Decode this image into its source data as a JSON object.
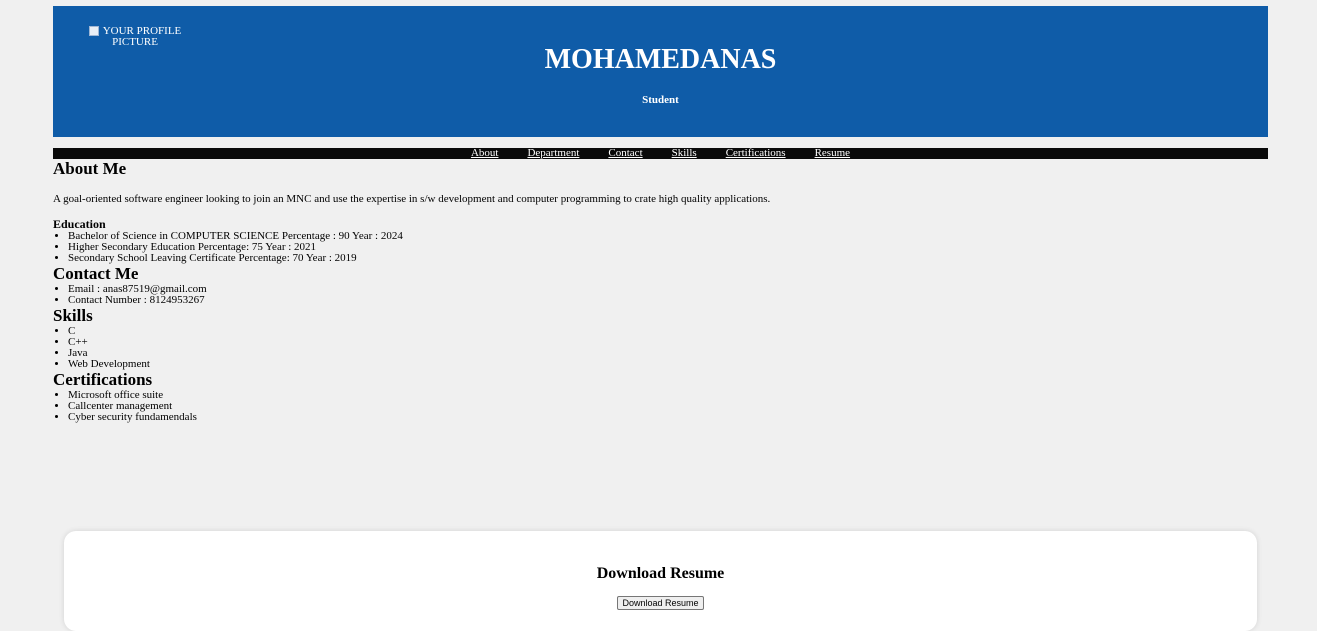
{
  "header": {
    "profile_alt": "YOUR PROFILE PICTURE",
    "name": "MOHAMEDANAS",
    "role": "Student",
    "background_color": "#0f5ca8"
  },
  "nav": {
    "items": [
      "About",
      "Department",
      "Contact",
      "Skills",
      "Certifications",
      "Resume"
    ]
  },
  "about": {
    "title": "About Me",
    "text": "A goal-oriented software engineer looking to join an MNC and use the expertise in s/w development and computer programming to crate high quality applications.",
    "education_title": "Education",
    "education": [
      "Bachelor of Science in COMPUTER SCIENCE Percentage : 90 Year : 2024",
      "Higher Secondary Education Percentage: 75 Year : 2021",
      "Secondary School Leaving Certificate Percentage: 70 Year : 2019"
    ]
  },
  "contact": {
    "title": "Contact Me",
    "items": [
      "Email : anas87519@gmail.com",
      "Contact Number : 8124953267"
    ]
  },
  "skills": {
    "title": "Skills",
    "items": [
      "C",
      "C++",
      "Java",
      "Web Development"
    ]
  },
  "certifications": {
    "title": "Certifications",
    "items": [
      "Microsoft office suite",
      "Callcenter management",
      "Cyber security fundamendals"
    ]
  },
  "resume": {
    "title": "Download Resume",
    "button_label": "Download Resume"
  }
}
